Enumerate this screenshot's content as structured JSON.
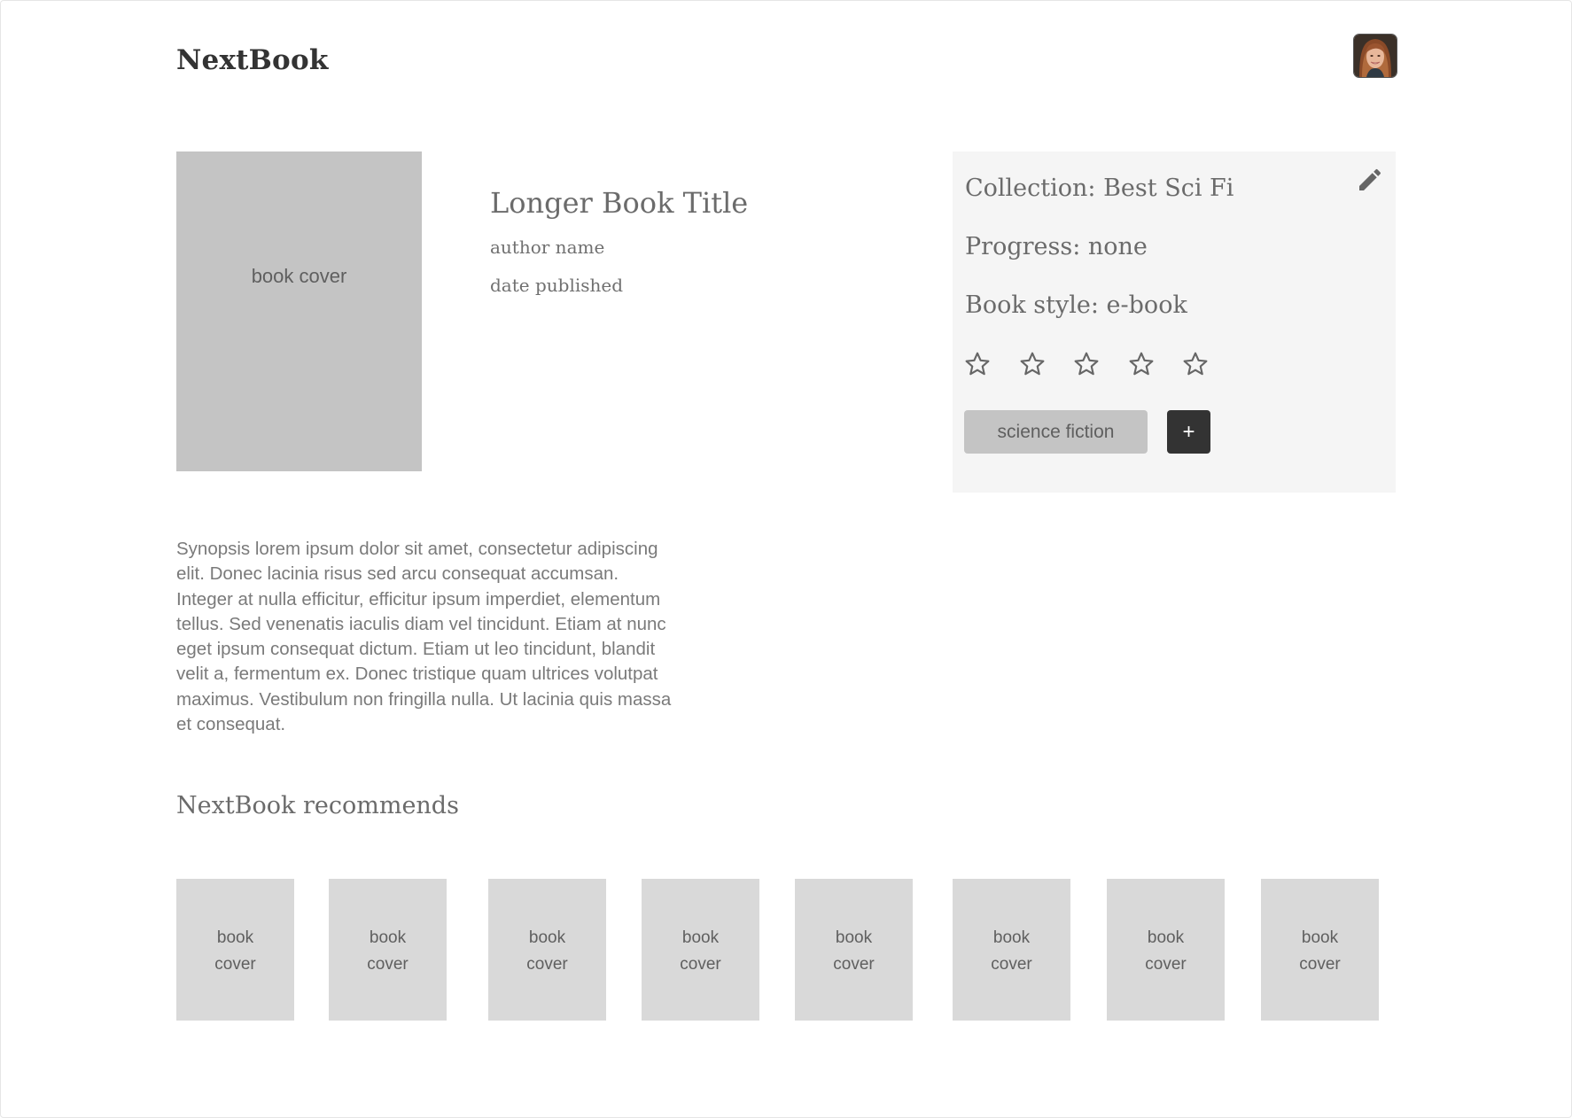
{
  "header": {
    "logo": "NextBook",
    "avatar_icon": "user-avatar-photo"
  },
  "book": {
    "cover_label": "book cover",
    "title": "Longer Book Title",
    "author": "author name",
    "date": "date published"
  },
  "info": {
    "collection": "Collection: Best Sci Fi",
    "progress": "Progress: none",
    "style": "Book style: e-book",
    "edit_icon": "pencil-icon",
    "rating": 0,
    "rating_max": 5,
    "tag": "science fiction",
    "add_label": "+"
  },
  "synopsis": "Synopsis lorem ipsum dolor sit amet, consectetur adipiscing elit. Donec lacinia risus sed arcu consequat accumsan. Integer at nulla efficitur, efficitur ipsum imperdiet, elementum tellus. Sed venenatis iaculis diam vel tincidunt. Etiam at nunc eget ipsum consequat dictum. Etiam ut leo tincidunt, blandit velit a, fermentum ex. Donec tristique quam ultrices volutpat maximus. Vestibulum non fringilla nulla. Ut lacinia quis massa et consequat.",
  "recommendations": {
    "heading": "NextBook recommends",
    "items": [
      {
        "label": "book cover"
      },
      {
        "label": "book cover"
      },
      {
        "label": "book cover"
      },
      {
        "label": "book cover"
      },
      {
        "label": "book cover"
      },
      {
        "label": "book cover"
      },
      {
        "label": "book cover"
      },
      {
        "label": "book cover"
      }
    ]
  },
  "colors": {
    "dark": "#333333",
    "cover_main": "#c4c4c4",
    "cover_rec": "#d9d9d9",
    "panel": "#f5f5f5"
  }
}
